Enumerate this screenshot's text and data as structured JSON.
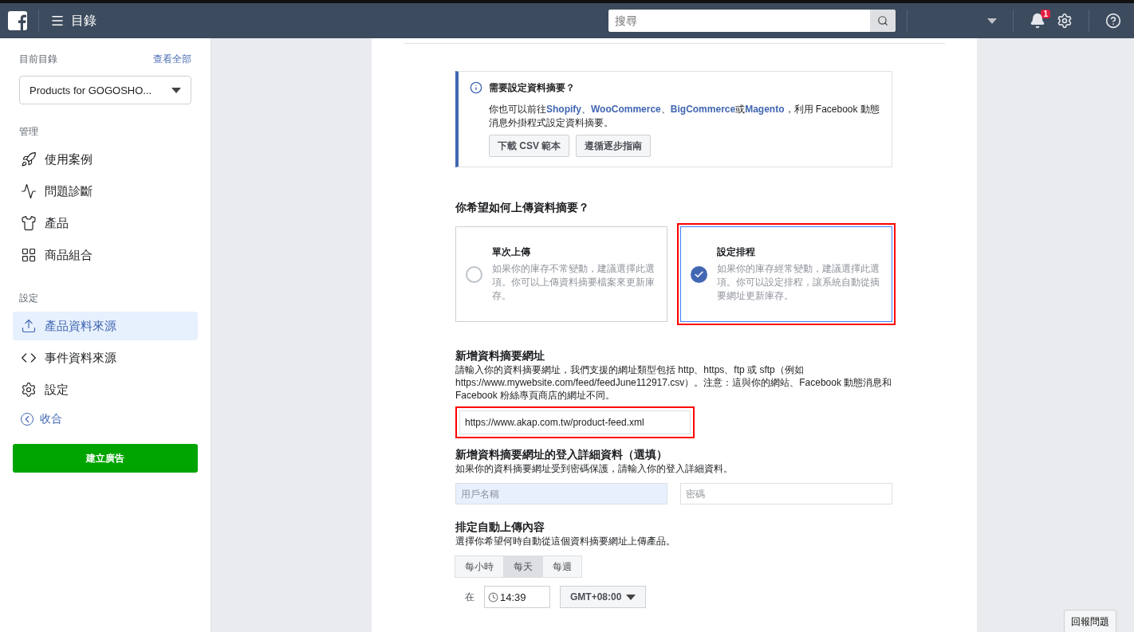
{
  "topbar": {
    "title": "目錄",
    "search": {
      "placeholder": "搜尋"
    },
    "notifications": "1"
  },
  "sidebar": {
    "current_label": "目前目錄",
    "view_all": "查看全部",
    "catalog": "Products for GOGOSHO...",
    "sections": [
      {
        "heading": "管理",
        "items": [
          {
            "label": "使用案例",
            "selected": false
          },
          {
            "label": "問題診斷",
            "selected": false
          },
          {
            "label": "產品",
            "selected": false
          },
          {
            "label": "商品組合",
            "selected": false
          }
        ]
      },
      {
        "heading": "設定",
        "items": [
          {
            "label": "產品資料來源",
            "selected": true
          },
          {
            "label": "事件資料來源",
            "selected": false
          },
          {
            "label": "設定",
            "selected": false
          }
        ]
      }
    ],
    "collapse": "收合",
    "create_ad": "建立廣告"
  },
  "info": {
    "title": "需要設定資料摘要？",
    "text": [
      {
        "text": "你也可以前往",
        "kind": "text"
      },
      {
        "text": "Shopify",
        "kind": "link"
      },
      {
        "text": "、",
        "kind": "text"
      },
      {
        "text": "WooCommerce",
        "kind": "link"
      },
      {
        "text": "、",
        "kind": "text"
      },
      {
        "text": "BigCommerce",
        "kind": "link"
      },
      {
        "text": "或",
        "kind": "text"
      },
      {
        "text": "Magento",
        "kind": "link"
      },
      {
        "text": "，利用 Facebook 動態消息外掛程式設定資料摘要。",
        "kind": "text"
      }
    ],
    "buttons": [
      "下載 CSV 範本",
      "遵循逐步指南"
    ]
  },
  "upload": {
    "title": "你希望如何上傳資料摘要？",
    "options": [
      {
        "title": "單次上傳",
        "text": "如果你的庫存不常變動，建議選擇此選項。你可以上傳資料摘要檔案來更新庫存。",
        "selected": false,
        "highlighted": false
      },
      {
        "title": "設定排程",
        "text": "如果你的庫存經常變動，建議選擇此選項。你可以設定排程，讓系統自動從摘要網址更新庫存。",
        "selected": true,
        "highlighted": true
      }
    ]
  },
  "url": {
    "title": "新增資料摘要網址",
    "text": "請輸入你的資料摘要網址，我們支援的網址類型包括 http、https、ftp 或 sftp（例如 https://www.mywebsite.com/feed/feedJune112917.csv）。注意：這與你的網站、Facebook 動態消息和 Facebook 粉絲專頁商店的網址不同。",
    "value": "https://www.akap.com.tw/product-feed.xml",
    "highlighted": true
  },
  "login": {
    "title": "新增資料摘要網址的登入詳細資料（選填）",
    "text": "如果你的資料摘要網址受到密碼保護，請輸入你的登入詳細資料。",
    "username": {
      "placeholder": "用戶名稱",
      "focused": true
    },
    "password": {
      "placeholder": "密碼",
      "focused": false
    }
  },
  "schedule": {
    "title": "排定自動上傳內容",
    "text": "選擇你希望何時自動從這個資料摘要網址上傳產品。",
    "tabs": [
      {
        "label": "每小時",
        "selected": false
      },
      {
        "label": "每天",
        "selected": true
      },
      {
        "label": "每週",
        "selected": false
      }
    ],
    "at": "在",
    "time": "14:39",
    "timezone": "GMT+08:00"
  },
  "report": "回報問題"
}
